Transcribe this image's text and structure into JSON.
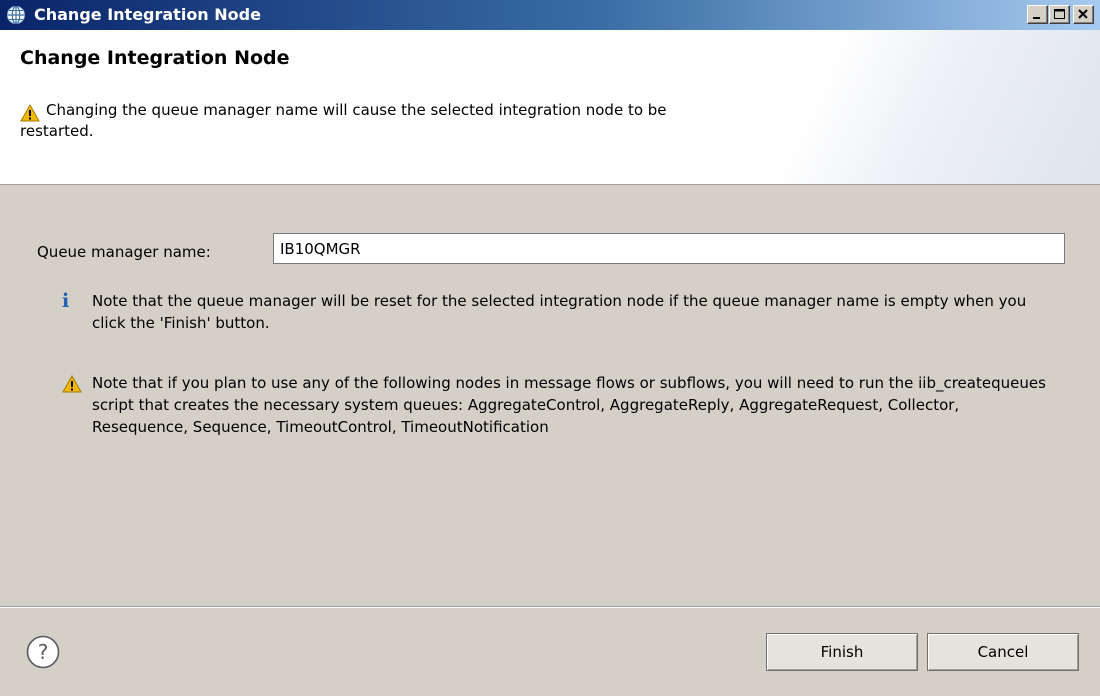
{
  "window": {
    "title": "Change Integration Node",
    "icons": {
      "app": "globe-icon",
      "minimize": "minimize-icon",
      "maximize": "maximize-icon",
      "close": "close-icon"
    }
  },
  "header": {
    "title": "Change Integration Node",
    "warning_line1": "Changing the queue manager name will cause the selected integration node to be",
    "warning_line2": "restarted.",
    "icon": "warning-icon"
  },
  "form": {
    "queue_manager_label": "Queue manager name:",
    "queue_manager_value": "IB10QMGR"
  },
  "notes": {
    "info_icon": "info-icon",
    "info_text": "Note that the queue manager will be reset for the selected integration node if the queue manager name is empty when you click the 'Finish' button.",
    "warning_icon": "warning-icon",
    "warning_text": "Note that if you plan to use any of the following nodes in message flows or subflows, you will need to run the iib_createqueues script that creates the necessary system queues: AggregateControl, AggregateReply, AggregateRequest, Collector, Resequence, Sequence, TimeoutControl, TimeoutNotification"
  },
  "footer": {
    "help_icon": "help-icon",
    "finish_label": "Finish",
    "cancel_label": "Cancel"
  },
  "colors": {
    "titlebar_start": "#0a246a",
    "titlebar_end": "#a6caf0",
    "dialog_background": "#d4d0c8",
    "warning": "#f2b705",
    "info": "#1f5fb4"
  }
}
